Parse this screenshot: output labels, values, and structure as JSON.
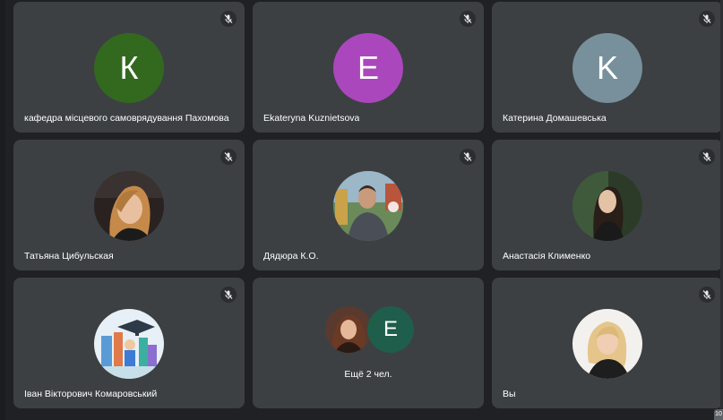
{
  "participants": [
    {
      "name": "кафедра місцевого самоврядування Пахомова",
      "initial": "К",
      "avatar_color": "#33691e",
      "muted": true,
      "type": "letter"
    },
    {
      "name": "Ekateryna Kuznietsova",
      "initial": "E",
      "avatar_color": "#ab47bc",
      "muted": true,
      "type": "letter"
    },
    {
      "name": "Катерина Домашевська",
      "initial": "K",
      "avatar_color": "#78909c",
      "muted": true,
      "type": "letter"
    },
    {
      "name": "Татьяна Цибульская",
      "muted": true,
      "type": "photo",
      "photo": "woman-long-hair"
    },
    {
      "name": "Дядюра К.О.",
      "muted": true,
      "type": "photo",
      "photo": "man-outdoor"
    },
    {
      "name": "Анастасія Клименко",
      "muted": true,
      "type": "photo",
      "photo": "woman-dark-hair"
    },
    {
      "name": "Іван Вікторович Комаровський",
      "muted": true,
      "type": "photo",
      "photo": "graduation-illustration"
    },
    {
      "type": "more",
      "label": "Ещё 2 чел.",
      "initials": [
        "E"
      ],
      "more_color": "#1e5e4a"
    },
    {
      "name": "Вы",
      "muted": true,
      "type": "photo",
      "photo": "woman-blonde"
    }
  ],
  "icons": {
    "mute": "mic-off-icon"
  },
  "badge": "10"
}
